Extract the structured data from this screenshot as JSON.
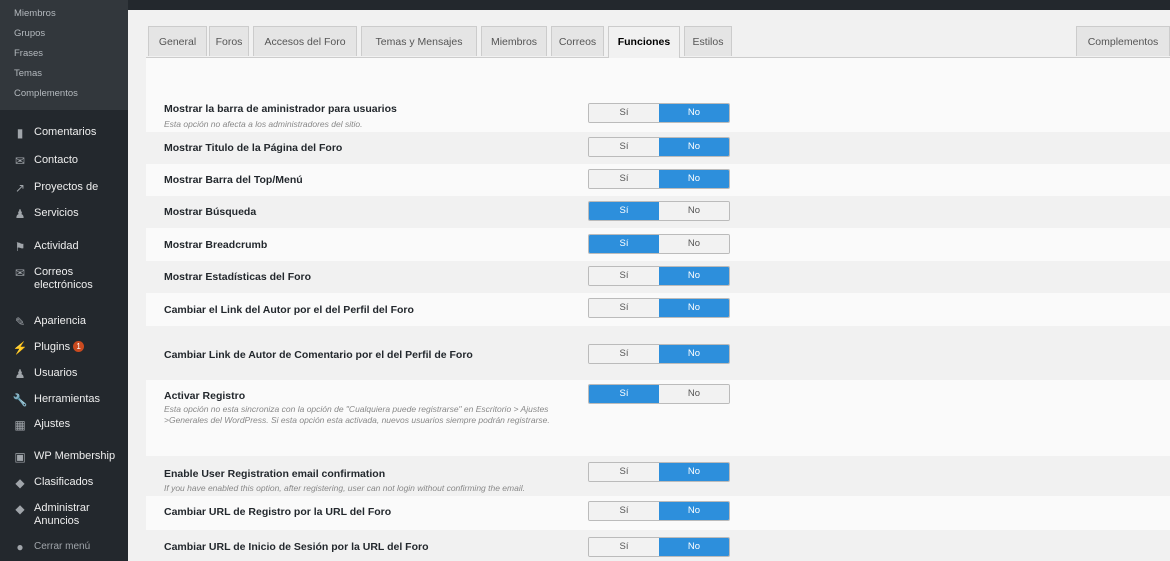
{
  "sidebar": {
    "submenu": [
      "Miembros",
      "Grupos",
      "Frases",
      "Temas",
      "Complementos"
    ],
    "items": [
      {
        "icon": "comment-icon",
        "glyph": "▮",
        "label": "Comentarios"
      },
      {
        "icon": "mail-icon",
        "glyph": "✉",
        "label": "Contacto"
      },
      {
        "icon": "pencil-icon",
        "glyph": "↗",
        "label": "Proyectos de"
      },
      {
        "icon": "people-icon",
        "glyph": "♟",
        "label": "Servicios"
      },
      {
        "icon": "activity-icon",
        "glyph": "⚑",
        "label": "Actividad"
      },
      {
        "icon": "mail-icon",
        "glyph": "✉",
        "label": "Correos electrónicos"
      },
      {
        "icon": "brush-icon",
        "glyph": "✎",
        "label": "Apariencia"
      },
      {
        "icon": "plug-icon",
        "glyph": "⚡",
        "label": "Plugins",
        "badge": "1"
      },
      {
        "icon": "user-icon",
        "glyph": "♟",
        "label": "Usuarios"
      },
      {
        "icon": "wrench-icon",
        "glyph": "🔧",
        "label": "Herramientas"
      },
      {
        "icon": "settings-icon",
        "glyph": "▦",
        "label": "Ajustes"
      },
      {
        "icon": "membership-icon",
        "glyph": "▣",
        "label": "WP Membership"
      },
      {
        "icon": "pin-icon",
        "glyph": "◆",
        "label": "Clasificados"
      },
      {
        "icon": "pin-icon",
        "glyph": "◆",
        "label": "Administrar Anuncios"
      },
      {
        "icon": "collapse-icon",
        "glyph": "●",
        "label": "Cerrar menú"
      }
    ]
  },
  "tabs": [
    {
      "label": "General",
      "active": false
    },
    {
      "label": "Foros",
      "active": false
    },
    {
      "label": "Accesos del Foro",
      "active": false
    },
    {
      "label": "Temas y Mensajes",
      "active": false
    },
    {
      "label": "Miembros",
      "active": false
    },
    {
      "label": "Correos",
      "active": false
    },
    {
      "label": "Funciones",
      "active": true
    },
    {
      "label": "Estilos",
      "active": false
    }
  ],
  "extra_tab": "Complementos",
  "toggle_labels": {
    "yes": "Sí",
    "no": "No"
  },
  "accent_color": "#2d8fdc",
  "settings": [
    {
      "label": "Mostrar la barra de aministrador para usuarios",
      "description": "Esta opción no afecta a los administradores del sitio.",
      "value": "No"
    },
    {
      "label": "Mostrar Titulo de la Página del Foro",
      "description": "",
      "value": "No"
    },
    {
      "label": "Mostrar Barra del Top/Menú",
      "description": "",
      "value": "No"
    },
    {
      "label": "Mostrar Búsqueda",
      "description": "",
      "value": "Sí"
    },
    {
      "label": "Mostrar Breadcrumb",
      "description": "",
      "value": "Sí"
    },
    {
      "label": "Mostrar Estadísticas del Foro",
      "description": "",
      "value": "No"
    },
    {
      "label": "Cambiar el Link del Autor por el del Perfil del Foro",
      "description": "",
      "value": "No"
    },
    {
      "label": "Cambiar Link de Autor de Comentario por el del Perfil de Foro",
      "description": "",
      "value": "No"
    },
    {
      "label": "Activar Registro",
      "description": "Esta opción no esta sincroniza con la opción de \"Cualquiera puede registrarse\" en Escritorio > Ajustes >Generales del WordPress. Si esta opción esta activada, nuevos usuarios siempre podrán registrarse.",
      "value": "Sí"
    },
    {
      "label": "Enable User Registration email confirmation",
      "description": "If you have enabled this option, after registering, user can not login without confirming the email.",
      "value": "No"
    },
    {
      "label": "Cambiar URL de Registro por la URL del Foro",
      "description": "",
      "value": "No"
    },
    {
      "label": "Cambiar URL de Inicio de Sesión por la URL del Foro",
      "description": "",
      "value": "No"
    }
  ]
}
